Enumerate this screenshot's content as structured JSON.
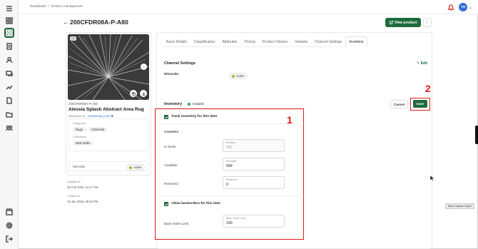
{
  "breadcrumb": {
    "root": "Dashboard",
    "current": "Product management"
  },
  "user": {
    "initials": "TH"
  },
  "page": {
    "title": "200CFDR08A-P-A80",
    "view_button": "View product"
  },
  "product": {
    "image_counter": "1/1",
    "sku": "200CFDR08A-P-A80",
    "name": "Alessia Splash Abstract Area Rug",
    "reference_label": "Reference ID -",
    "reference_id": "200cfdr08a-p-a80",
    "categories_label": "Categories",
    "category_parent": "Rugs",
    "category_child": "Alchemist",
    "collections_label": "Collections",
    "collection": "Best Seller",
    "wizorder_label": "Wizorder",
    "wizorder_status": "Active",
    "updated_label": "Updated at",
    "updated_value": "26 Feb 2026, 01:17 AM",
    "created_label": "Created at",
    "created_value": "19 Jan 2026, 08:19 PM"
  },
  "tabs": [
    "Basic Details",
    "Classification",
    "Attributes",
    "Pricing",
    "Product Volume",
    "Variants",
    "Channel Settings",
    "Inventory"
  ],
  "channel_settings": {
    "title": "Channel Settings",
    "edit": "Edit",
    "wizorder_label": "Wizorder",
    "wizorder_status": "Active"
  },
  "inventory": {
    "title": "Inventory",
    "status": "Available",
    "cancel": "Cancel",
    "save": "Save",
    "track_label": "Track inventory for this item",
    "counters_label": "Counters",
    "in_stock_label": "In Stock",
    "in_stock_field_label": "In Stock",
    "in_stock_value": "999",
    "available_label": "Available",
    "available_field_label": "Available",
    "available_value": "999",
    "reserved_label": "Reserved",
    "reserved_field_label": "Reserved",
    "reserved_value": "0",
    "backorder_toggle_label": "Allow backorders for this item",
    "backorder_limit_label": "Back Order Limit",
    "backorder_field_label": "Back Order Limit",
    "backorder_value": "100"
  },
  "annotations": {
    "one": "1",
    "two": "2"
  },
  "tooltip": "More Capture Types",
  "colors": {
    "brand_green": "#1e6b3c",
    "annotation_red": "#e01818",
    "status_dot": "#b7b32a"
  }
}
